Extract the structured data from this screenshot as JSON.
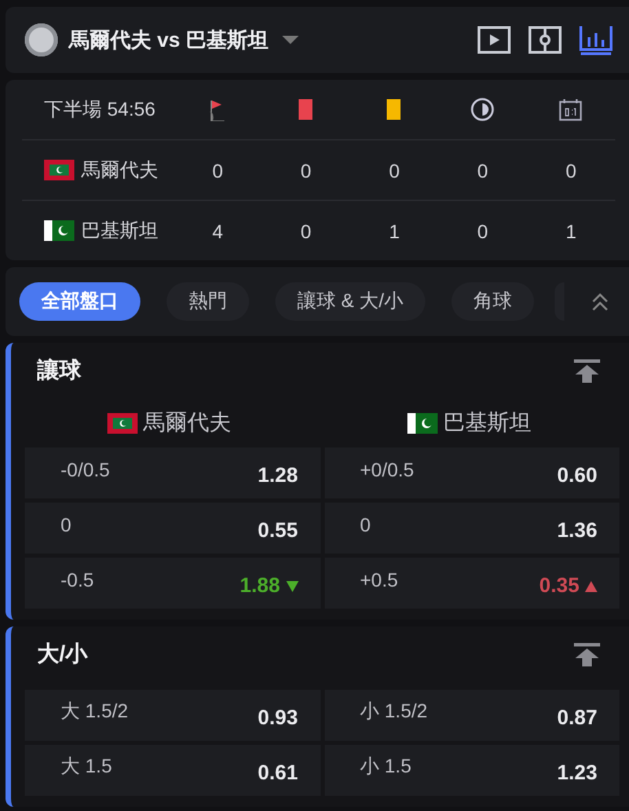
{
  "header": {
    "title": "馬爾代夫 vs 巴基斯坦",
    "views": [
      {
        "kind": "video",
        "selected": false
      },
      {
        "kind": "pitch",
        "selected": false
      },
      {
        "kind": "stats",
        "selected": true
      }
    ]
  },
  "stats": {
    "period": "下半場 54:56",
    "columns": [
      {
        "kind": "corner"
      },
      {
        "kind": "red-card"
      },
      {
        "kind": "yellow-card"
      },
      {
        "kind": "half"
      },
      {
        "kind": "score"
      }
    ],
    "teams": [
      {
        "name": "馬爾代夫",
        "kind": "maldives",
        "values": [
          "0",
          "0",
          "0",
          "0",
          "0"
        ]
      },
      {
        "name": "巴基斯坦",
        "kind": "pakistan",
        "values": [
          "4",
          "0",
          "1",
          "0",
          "1"
        ]
      }
    ]
  },
  "filters": [
    {
      "label": "全部盤口",
      "selected": true
    },
    {
      "label": "熱門",
      "selected": false
    },
    {
      "label": "讓球 & 大/小",
      "selected": false
    },
    {
      "label": "角球",
      "selected": false
    }
  ],
  "markets": [
    {
      "title": "讓球",
      "teams": [
        {
          "name": "馬爾代夫",
          "kind": "maldives"
        },
        {
          "name": "巴基斯坦",
          "kind": "pakistan"
        }
      ],
      "rows": [
        [
          {
            "line": "-0/0.5",
            "odds": "1.28",
            "kind": "steady"
          },
          {
            "line": "+0/0.5",
            "odds": "0.60",
            "kind": "steady"
          }
        ],
        [
          {
            "line": "0",
            "odds": "0.55",
            "kind": "steady"
          },
          {
            "line": "0",
            "odds": "1.36",
            "kind": "steady"
          }
        ],
        [
          {
            "line": "-0.5",
            "odds": "1.88",
            "kind": "falling"
          },
          {
            "line": "+0.5",
            "odds": "0.35",
            "kind": "rising"
          }
        ]
      ]
    },
    {
      "title": "大/小",
      "rows": [
        [
          {
            "line": "大 1.5/2",
            "odds": "0.93",
            "kind": "steady"
          },
          {
            "line": "小 1.5/2",
            "odds": "0.87",
            "kind": "steady"
          }
        ],
        [
          {
            "line": "大 1.5",
            "odds": "0.61",
            "kind": "steady"
          },
          {
            "line": "小 1.5",
            "odds": "1.23",
            "kind": "steady"
          }
        ]
      ]
    }
  ]
}
